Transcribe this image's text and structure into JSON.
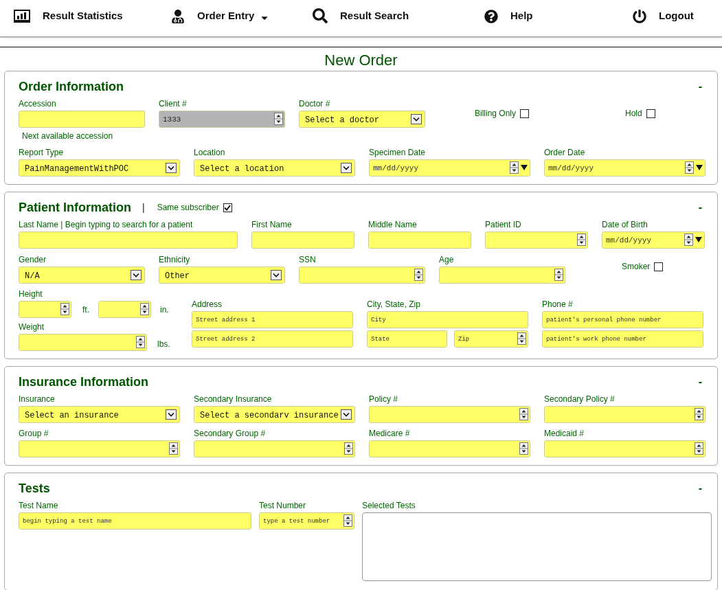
{
  "nav": [
    {
      "label": "Result Statistics",
      "menu": false
    },
    {
      "label": "Order Entry",
      "menu": true
    },
    {
      "label": "Result Search",
      "menu": false
    },
    {
      "label": "Help",
      "menu": false
    },
    {
      "label": "Logout",
      "menu": false
    }
  ],
  "title": "New Order",
  "order": {
    "heading": "Order Information",
    "collapse": "-",
    "accession": {
      "label": "Accession",
      "kind": "text",
      "hint": "Next available accession"
    },
    "client": {
      "label": "Client #",
      "kind": "number",
      "value": "1333",
      "disabled": true
    },
    "doctor": {
      "label": "Doctor #",
      "kind": "select",
      "value": "Select a doctor"
    },
    "billing_only": {
      "label": "Billing Only",
      "checked": false
    },
    "hold": {
      "label": "Hold",
      "checked": false
    },
    "report_type": {
      "label": "Report Type",
      "kind": "select",
      "value": "PainManagementWithPOC"
    },
    "location": {
      "label": "Location",
      "kind": "select",
      "value": "Select a location"
    },
    "specimen_date": {
      "label": "Specimen Date",
      "kind": "date",
      "placeholder": "mm/dd/yyyy"
    },
    "order_date": {
      "label": "Order Date",
      "kind": "date",
      "placeholder": "mm/dd/yyyy"
    }
  },
  "patient": {
    "heading": "Patient Information",
    "separator": "|",
    "same_subscriber": {
      "label": "Same subscriber",
      "checked": true
    },
    "collapse": "-",
    "last_name": {
      "label": "Last Name | Begin typing to search for a patient",
      "kind": "text"
    },
    "first_name": {
      "label": "First Name",
      "kind": "text"
    },
    "middle_name": {
      "label": "Middle Name",
      "kind": "text"
    },
    "patient_id": {
      "label": "Patient ID",
      "kind": "number"
    },
    "dob": {
      "label": "Date of Birth",
      "kind": "date",
      "placeholder": "mm/dd/yyyy"
    },
    "gender": {
      "label": "Gender",
      "kind": "select",
      "value": "N/A"
    },
    "ethnicity": {
      "label": "Ethnicity",
      "kind": "select",
      "value": "Other"
    },
    "ssn": {
      "label": "SSN",
      "kind": "number"
    },
    "age": {
      "label": "Age",
      "kind": "number"
    },
    "smoker": {
      "label": "Smoker",
      "checked": false
    },
    "height": {
      "label": "Height",
      "feet": {
        "kind": "number",
        "unit": "ft."
      },
      "inches": {
        "kind": "number",
        "unit": "in."
      }
    },
    "weight": {
      "label": "Weight",
      "kind": "number",
      "unit": "lbs."
    },
    "address": {
      "label": "Address",
      "lines": [
        {
          "kind": "text",
          "placeholder": "Street address 1"
        },
        {
          "kind": "text",
          "placeholder": "Street address 2"
        }
      ]
    },
    "city_state_zip": {
      "label": "City, State, Zip",
      "city": {
        "kind": "text",
        "placeholder": "City"
      },
      "state": {
        "kind": "text",
        "placeholder": "State"
      },
      "zip": {
        "kind": "number",
        "placeholder": "Zip"
      }
    },
    "phone": {
      "label": "Phone #",
      "lines": [
        {
          "kind": "text",
          "placeholder": "patient's personal phone number"
        },
        {
          "kind": "text",
          "placeholder": "patient's work phone number"
        }
      ]
    }
  },
  "insurance": {
    "heading": "Insurance Information",
    "collapse": "-",
    "fields": [
      {
        "label": "Insurance",
        "kind": "select",
        "value": "Select an insurance"
      },
      {
        "label": "Secondary Insurance",
        "kind": "select",
        "value": "Select a secondarv insurance"
      },
      {
        "label": "Policy #",
        "kind": "number"
      },
      {
        "label": "Secondary Policy #",
        "kind": "number"
      },
      {
        "label": "Group #",
        "kind": "number"
      },
      {
        "label": "Secondary Group #",
        "kind": "number"
      },
      {
        "label": "Medicare #",
        "kind": "number"
      },
      {
        "label": "Medicaid #",
        "kind": "number"
      }
    ]
  },
  "tests": {
    "heading": "Tests",
    "collapse": "-",
    "test_name": {
      "label": "Test Name",
      "kind": "text",
      "placeholder": "begin typing a test name"
    },
    "test_number": {
      "label": "Test Number",
      "kind": "number",
      "placeholder": "type a test number"
    },
    "selected_tests": {
      "label": "Selected Tests",
      "kind": "textarea"
    }
  }
}
